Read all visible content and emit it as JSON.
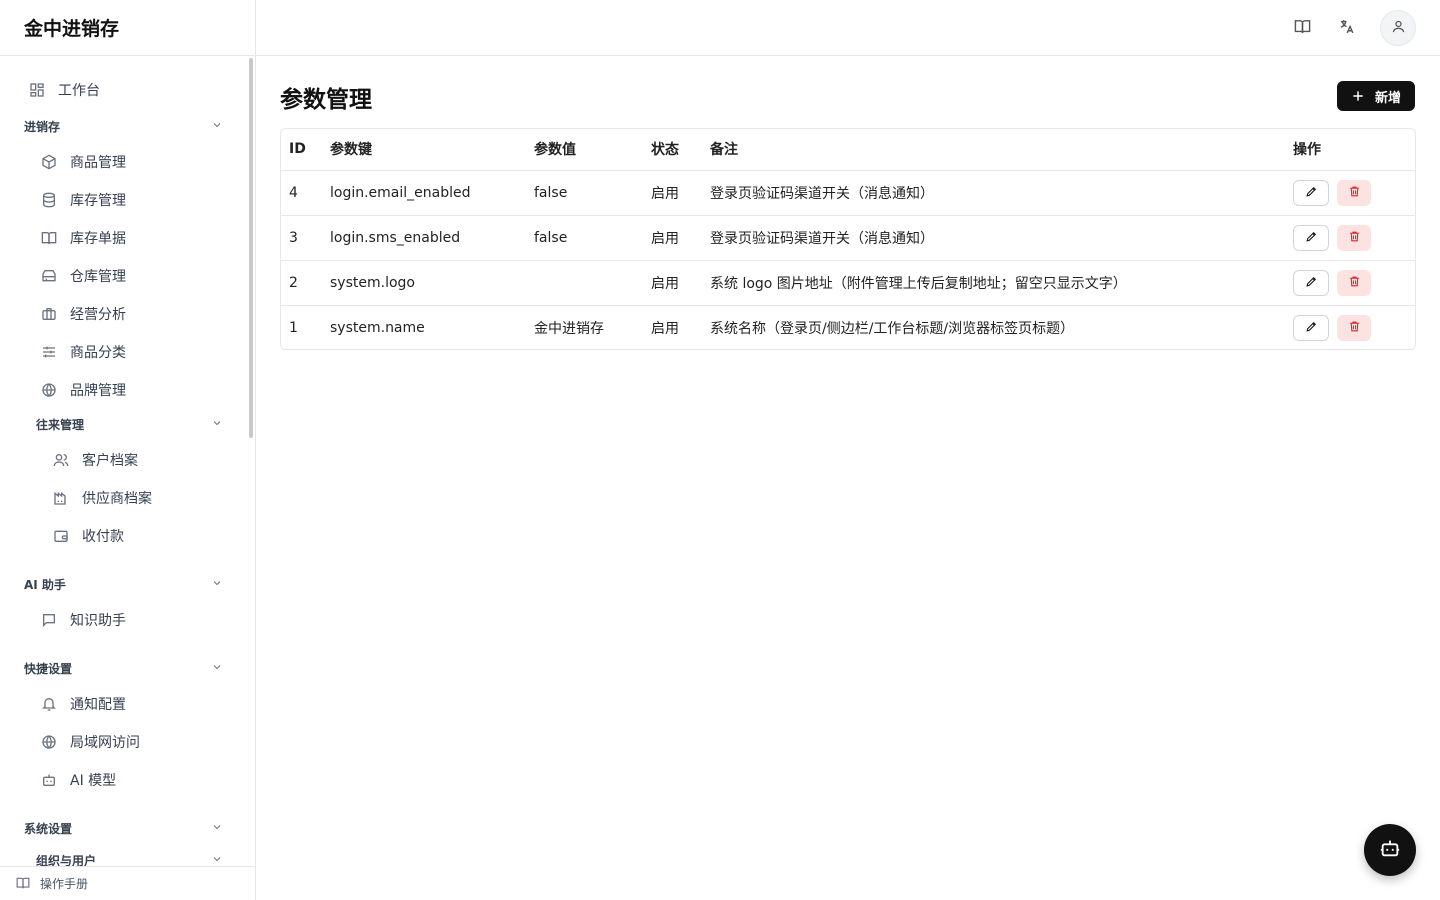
{
  "app": {
    "title": "金中进销存"
  },
  "sidebar": {
    "dashboard": "工作台",
    "groups": {
      "inventory": "进销存",
      "partners": "往来管理",
      "ai": "AI 助手",
      "shortcuts": "快捷设置",
      "system": "系统设置",
      "org": "组织与用户"
    },
    "inventory_items": [
      "商品管理",
      "库存管理",
      "库存单据",
      "仓库管理",
      "经营分析",
      "商品分类",
      "品牌管理"
    ],
    "partner_items": [
      "客户档案",
      "供应商档案",
      "收付款"
    ],
    "ai_items": [
      "知识助手"
    ],
    "shortcut_items": [
      "通知配置",
      "局域网访问",
      "AI 模型"
    ],
    "footer": "操作手册"
  },
  "page": {
    "title": "参数管理",
    "add_label": "新增"
  },
  "table": {
    "headers": [
      "ID",
      "参数键",
      "参数值",
      "状态",
      "备注",
      "操作"
    ],
    "rows": [
      {
        "id": "4",
        "key": "login.email_enabled",
        "value": "false",
        "status": "启用",
        "remark": "登录页验证码渠道开关（消息通知）"
      },
      {
        "id": "3",
        "key": "login.sms_enabled",
        "value": "false",
        "status": "启用",
        "remark": "登录页验证码渠道开关（消息通知）"
      },
      {
        "id": "2",
        "key": "system.logo",
        "value": "",
        "status": "启用",
        "remark": "系统 logo 图片地址（附件管理上传后复制地址；留空只显示文字）"
      },
      {
        "id": "1",
        "key": "system.name",
        "value": "金中进销存",
        "status": "启用",
        "remark": "系统名称（登录页/侧边栏/工作台标题/浏览器标签页标题）"
      }
    ]
  },
  "icons": {
    "dashboard": "grid-icon",
    "product": "box-icon",
    "stock": "database-icon",
    "docs": "book-icon",
    "warehouse": "warehouse-icon",
    "analysis": "briefcase-icon",
    "category": "sliders-icon",
    "brand": "globe-icon",
    "customer": "users-icon",
    "supplier": "factory-icon",
    "payment": "wallet-icon",
    "assistant": "message-icon",
    "notify": "bell-icon",
    "lan": "globe-icon",
    "model": "bot-icon"
  },
  "colors": {
    "primary": "#111111",
    "danger": "#dc2626",
    "danger_bg": "#fde2e2",
    "border": "#e5e7eb"
  }
}
